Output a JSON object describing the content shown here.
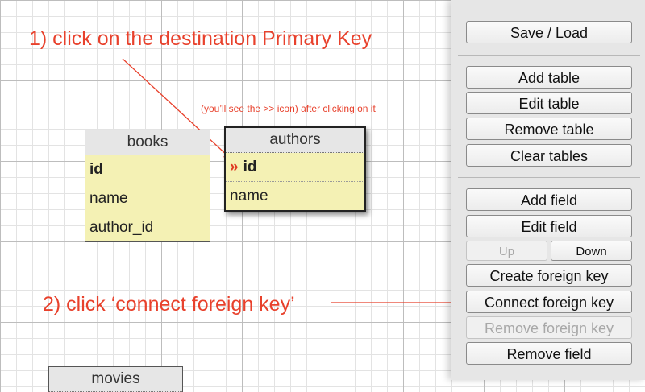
{
  "annotations": {
    "step1": "1) click on the destination Primary Key",
    "hint": "(you’ll see the >> icon) after clicking on it",
    "step2": "2) click ‘connect foreign key’"
  },
  "tables": {
    "books": {
      "name": "books",
      "fields": [
        "id",
        "name",
        "author_id"
      ]
    },
    "authors": {
      "name": "authors",
      "marker": "»",
      "fields": [
        "id",
        "name"
      ]
    },
    "movies": {
      "name": "movies"
    }
  },
  "panel": {
    "save_load": "Save / Load",
    "add_table": "Add table",
    "edit_table": "Edit table",
    "remove_table": "Remove table",
    "clear_tables": "Clear tables",
    "add_field": "Add field",
    "edit_field": "Edit field",
    "up": "Up",
    "down": "Down",
    "create_fk": "Create foreign key",
    "connect_fk": "Connect foreign key",
    "remove_fk": "Remove foreign key",
    "remove_field": "Remove field"
  },
  "colors": {
    "annotation": "#e8412c",
    "table_body": "#f4f1b4",
    "table_header": "#e6e6e6",
    "panel": "#e6e6e6"
  }
}
